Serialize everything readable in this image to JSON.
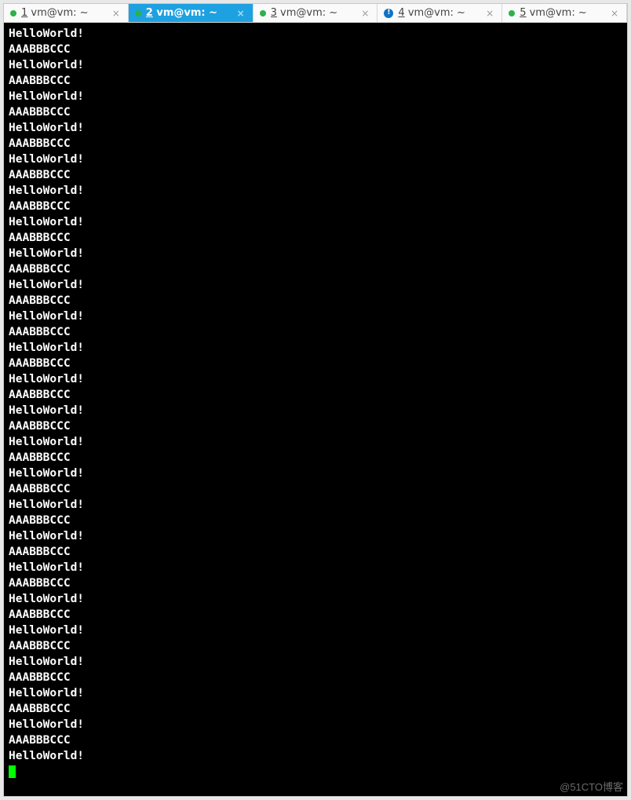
{
  "tabs": [
    {
      "num": "1",
      "title": "vm@vm: ~",
      "indicator": "dot",
      "active": false
    },
    {
      "num": "2",
      "title": "vm@vm: ~",
      "indicator": "dot",
      "active": true
    },
    {
      "num": "3",
      "title": "vm@vm: ~",
      "indicator": "dot",
      "active": false
    },
    {
      "num": "4",
      "title": "vm@vm: ~",
      "indicator": "info",
      "active": false
    },
    {
      "num": "5",
      "title": "vm@vm: ~",
      "indicator": "dot",
      "active": false
    }
  ],
  "close_glyph": "×",
  "info_glyph": "!",
  "terminal": {
    "lines": [
      "HelloWorld!",
      "AAABBBCCC",
      "HelloWorld!",
      "AAABBBCCC",
      "HelloWorld!",
      "AAABBBCCC",
      "HelloWorld!",
      "AAABBBCCC",
      "HelloWorld!",
      "AAABBBCCC",
      "HelloWorld!",
      "AAABBBCCC",
      "HelloWorld!",
      "AAABBBCCC",
      "HelloWorld!",
      "AAABBBCCC",
      "HelloWorld!",
      "AAABBBCCC",
      "HelloWorld!",
      "AAABBBCCC",
      "HelloWorld!",
      "AAABBBCCC",
      "HelloWorld!",
      "AAABBBCCC",
      "HelloWorld!",
      "AAABBBCCC",
      "HelloWorld!",
      "AAABBBCCC",
      "HelloWorld!",
      "AAABBBCCC",
      "HelloWorld!",
      "AAABBBCCC",
      "HelloWorld!",
      "AAABBBCCC",
      "HelloWorld!",
      "AAABBBCCC",
      "HelloWorld!",
      "AAABBBCCC",
      "HelloWorld!",
      "AAABBBCCC",
      "HelloWorld!",
      "AAABBBCCC",
      "HelloWorld!",
      "AAABBBCCC",
      "HelloWorld!",
      "AAABBBCCC",
      "HelloWorld!"
    ]
  },
  "watermark": "@51CTO博客"
}
